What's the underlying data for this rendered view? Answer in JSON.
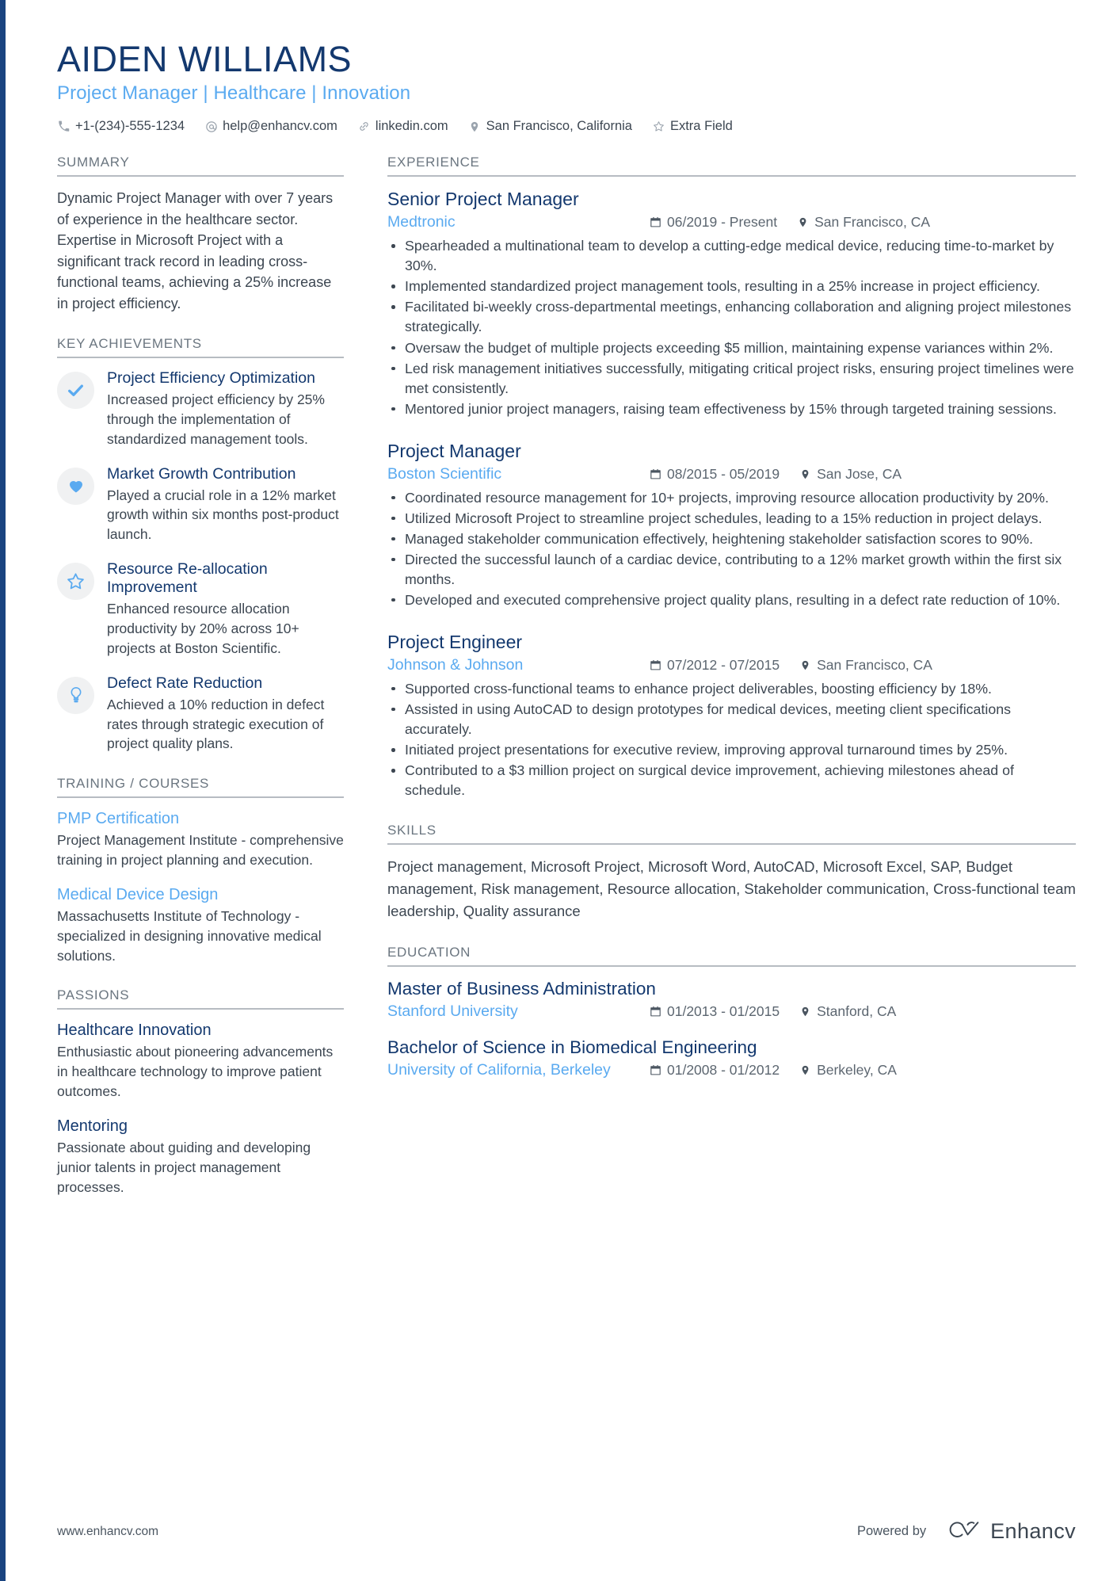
{
  "theme": {
    "navy": "#13386e",
    "light_blue": "#5aaaf0",
    "body_text": "#3c4651",
    "section_label": "#6b7680",
    "rule": "#b7bcc2",
    "badge_bg": "#f0f1f2",
    "edge_bar": "#1a4480"
  },
  "header": {
    "name": "AIDEN WILLIAMS",
    "headline": "Project Manager | Healthcare | Innovation",
    "contacts": [
      {
        "icon": "phone-icon",
        "text": "+1-(234)-555-1234"
      },
      {
        "icon": "email-icon",
        "text": "help@enhancv.com"
      },
      {
        "icon": "link-icon",
        "text": "linkedin.com"
      },
      {
        "icon": "location-icon",
        "text": "San Francisco, California"
      },
      {
        "icon": "star-icon",
        "text": "Extra Field"
      }
    ]
  },
  "sidebar": {
    "summary": {
      "title": "SUMMARY",
      "text": "Dynamic Project Manager with over 7 years of experience in the healthcare sector. Expertise in Microsoft Project with a significant track record in leading cross-functional teams, achieving a 25% increase in project efficiency."
    },
    "key_achievements": {
      "title": "KEY ACHIEVEMENTS",
      "items": [
        {
          "icon": "check-icon",
          "title": "Project Efficiency Optimization",
          "description": "Increased project efficiency by 25% through the implementation of standardized management tools."
        },
        {
          "icon": "heart-icon",
          "title": "Market Growth Contribution",
          "description": "Played a crucial role in a 12% market growth within six months post-product launch."
        },
        {
          "icon": "star-outline-icon",
          "title": "Resource Re-allocation Improvement",
          "description": "Enhanced resource allocation productivity by 20% across 10+ projects at Boston Scientific."
        },
        {
          "icon": "lightbulb-icon",
          "title": "Defect Rate Reduction",
          "description": "Achieved a 10% reduction in defect rates through strategic execution of project quality plans."
        }
      ]
    },
    "training": {
      "title": "TRAINING / COURSES",
      "items": [
        {
          "title": "PMP Certification",
          "description": "Project Management Institute - comprehensive training in project planning and execution."
        },
        {
          "title": "Medical Device Design",
          "description": "Massachusetts Institute of Technology - specialized in designing innovative medical solutions."
        }
      ]
    },
    "passions": {
      "title": "PASSIONS",
      "items": [
        {
          "title": "Healthcare Innovation",
          "description": "Enthusiastic about pioneering advancements in healthcare technology to improve patient outcomes."
        },
        {
          "title": "Mentoring",
          "description": "Passionate about guiding and developing junior talents in project management processes."
        }
      ]
    }
  },
  "main": {
    "experience": {
      "title": "EXPERIENCE",
      "jobs": [
        {
          "title": "Senior Project Manager",
          "company": "Medtronic",
          "dates": "06/2019 - Present",
          "location": "San Francisco, CA",
          "bullets": [
            "Spearheaded a multinational team to develop a cutting-edge medical device, reducing time-to-market by 30%.",
            "Implemented standardized project management tools, resulting in a 25% increase in project efficiency.",
            "Facilitated bi-weekly cross-departmental meetings, enhancing collaboration and aligning project milestones strategically.",
            "Oversaw the budget of multiple projects exceeding $5 million, maintaining expense variances within 2%.",
            "Led risk management initiatives successfully, mitigating critical project risks, ensuring project timelines were met consistently.",
            "Mentored junior project managers, raising team effectiveness by 15% through targeted training sessions."
          ]
        },
        {
          "title": "Project Manager",
          "company": "Boston Scientific",
          "dates": "08/2015 - 05/2019",
          "location": "San Jose, CA",
          "bullets": [
            "Coordinated resource management for 10+ projects, improving resource allocation productivity by 20%.",
            "Utilized Microsoft Project to streamline project schedules, leading to a 15% reduction in project delays.",
            "Managed stakeholder communication effectively, heightening stakeholder satisfaction scores to 90%.",
            "Directed the successful launch of a cardiac device, contributing to a 12% market growth within the first six months.",
            "Developed and executed comprehensive project quality plans, resulting in a defect rate reduction of 10%."
          ]
        },
        {
          "title": "Project Engineer",
          "company": "Johnson & Johnson",
          "dates": "07/2012 - 07/2015",
          "location": "San Francisco, CA",
          "bullets": [
            "Supported cross-functional teams to enhance project deliverables, boosting efficiency by 18%.",
            "Assisted in using AutoCAD to design prototypes for medical devices, meeting client specifications accurately.",
            "Initiated project presentations for executive review, improving approval turnaround times by 25%.",
            "Contributed to a $3 million project on surgical device improvement, achieving milestones ahead of schedule."
          ]
        }
      ]
    },
    "skills": {
      "title": "SKILLS",
      "text": "Project management, Microsoft Project, Microsoft Word, AutoCAD, Microsoft Excel, SAP, Budget management, Risk management, Resource allocation, Stakeholder communication, Cross-functional team leadership, Quality assurance"
    },
    "education": {
      "title": "EDUCATION",
      "items": [
        {
          "degree": "Master of Business Administration",
          "school": "Stanford University",
          "dates": "01/2013 - 01/2015",
          "location": "Stanford, CA"
        },
        {
          "degree": "Bachelor of Science in Biomedical Engineering",
          "school": "University of California, Berkeley",
          "dates": "01/2008 - 01/2012",
          "location": "Berkeley, CA"
        }
      ]
    }
  },
  "footer": {
    "url": "www.enhancv.com",
    "powered_by": "Powered by",
    "brand": "Enhancv"
  }
}
